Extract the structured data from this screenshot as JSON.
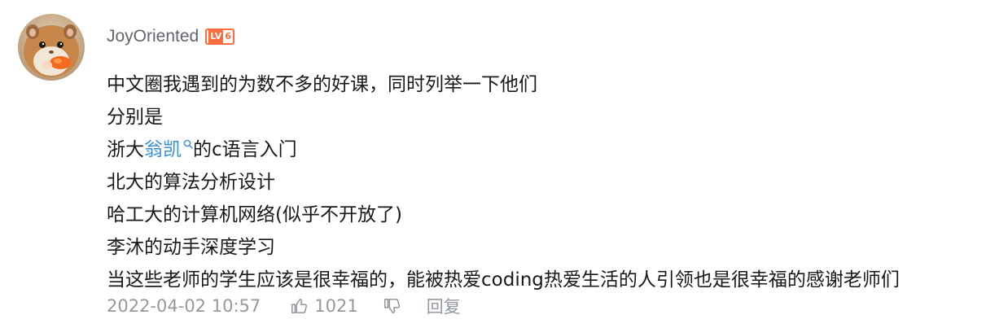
{
  "comment": {
    "username": "JoyOriented",
    "level_badge": {
      "prefix": "LV",
      "number": "6",
      "color": "#ff6b3d"
    },
    "lines": [
      {
        "text": "中文圈我遇到的为数不多的好课，同时列举一下他们"
      },
      {
        "text": "分别是"
      },
      {
        "before": "浙大",
        "link": "翁凯",
        "after": "的c语言入门"
      },
      {
        "text": "北大的算法分析设计"
      },
      {
        "text": "哈工大的计算机网络(似乎不开放了)"
      },
      {
        "text": "李沐的动手深度学习"
      },
      {
        "text": "当这些老师的学生应该是很幸福的，能被热爱coding热爱生活的人引领也是很幸福的感谢老师们"
      }
    ],
    "footer": {
      "timestamp": "2022-04-02 10:57",
      "like_count": "1021",
      "reply_label": "回复",
      "like_icon": "thumbs-up-icon",
      "dislike_icon": "thumbs-down-icon"
    },
    "colors": {
      "link": "#3a8dd7",
      "meta_text": "#9499a0",
      "body_text": "#18191c"
    }
  }
}
